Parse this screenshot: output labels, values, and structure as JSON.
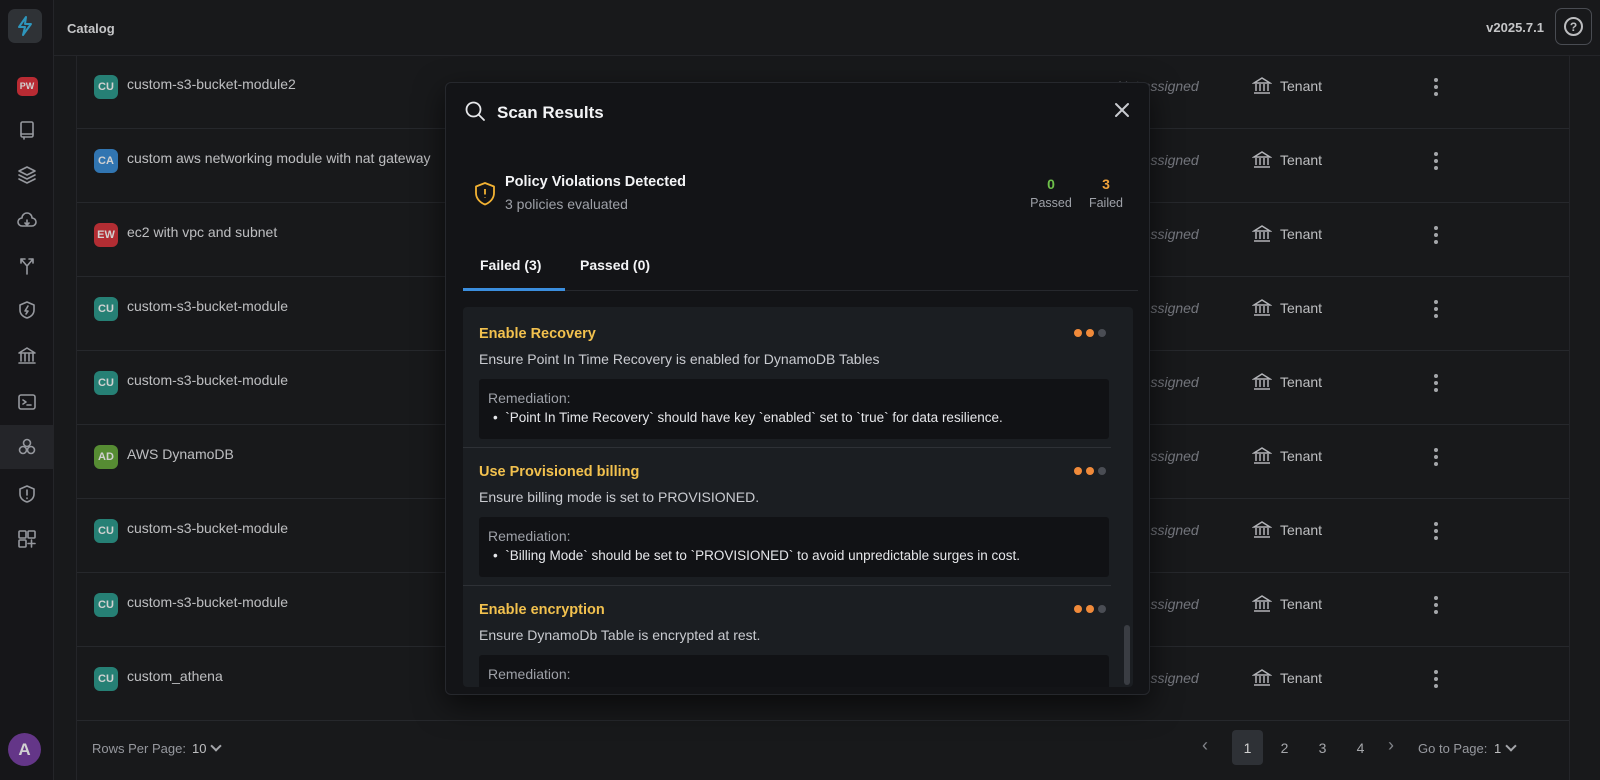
{
  "header": {
    "title": "Catalog",
    "version": "v2025.7.1",
    "help_icon": "help-circle-icon"
  },
  "sidebar": {
    "logo": "app-logo",
    "badge": "PW",
    "items": [
      {
        "icon": "book-icon"
      },
      {
        "icon": "layers-icon"
      },
      {
        "icon": "cloud-icon"
      },
      {
        "icon": "fork-icon"
      },
      {
        "icon": "shield-bolt-icon"
      },
      {
        "icon": "bank-icon"
      },
      {
        "icon": "terminal-icon"
      },
      {
        "icon": "modules-icon"
      },
      {
        "icon": "shield-alert-icon"
      },
      {
        "icon": "add-widget-icon"
      }
    ],
    "user_initial": "A"
  },
  "table": {
    "rows": [
      {
        "initials": "CU",
        "color": "#2f9d8f",
        "name": "custom-s3-bucket-module2",
        "assigned": "Not assigned",
        "scope": "Tenant"
      },
      {
        "initials": "CA",
        "color": "#3c8fd8",
        "name": "custom aws networking module with nat gateway",
        "assigned": "Not assigned",
        "scope": "Tenant"
      },
      {
        "initials": "EW",
        "color": "#d9383f",
        "name": "ec2 with vpc and subnet",
        "assigned": "Not assigned",
        "scope": "Tenant"
      },
      {
        "initials": "CU",
        "color": "#2f9d8f",
        "name": "custom-s3-bucket-module",
        "assigned": "Not assigned",
        "scope": "Tenant"
      },
      {
        "initials": "CU",
        "color": "#2f9d8f",
        "name": "custom-s3-bucket-module",
        "assigned": "Not assigned",
        "scope": "Tenant"
      },
      {
        "initials": "AD",
        "color": "#6aab3f",
        "name": "AWS DynamoDB",
        "assigned": "Not assigned",
        "scope": "Tenant"
      },
      {
        "initials": "CU",
        "color": "#2f9d8f",
        "name": "custom-s3-bucket-module",
        "assigned": "Not assigned",
        "scope": "Tenant"
      },
      {
        "initials": "CU",
        "color": "#2f9d8f",
        "name": "custom-s3-bucket-module",
        "assigned": "Not assigned",
        "scope": "Tenant"
      },
      {
        "initials": "CU",
        "color": "#2f9d8f",
        "name": "custom_athena",
        "assigned": "Not assigned",
        "scope": "Tenant"
      }
    ]
  },
  "pagination": {
    "rows_per_page_label": "Rows Per Page:",
    "rows_per_page": "10",
    "pages": [
      "1",
      "2",
      "3",
      "4"
    ],
    "current_page": "1",
    "goto_label": "Go to Page:",
    "goto_value": "1"
  },
  "modal": {
    "title": "Scan Results",
    "summary_title": "Policy Violations Detected",
    "summary_sub": "3 policies evaluated",
    "passed_count": "0",
    "passed_label": "Passed",
    "failed_count": "3",
    "failed_label": "Failed",
    "tabs": [
      "Failed (3)",
      "Passed (0)"
    ],
    "results": [
      {
        "title": "Enable Recovery",
        "desc": "Ensure Point In Time Recovery is enabled for DynamoDB Tables",
        "remediation_label": "Remediation:",
        "remediation": "`Point In Time Recovery` should have key `enabled` set to `true` for data resilience."
      },
      {
        "title": "Use Provisioned billing",
        "desc": "Ensure billing mode is set to PROVISIONED.",
        "remediation_label": "Remediation:",
        "remediation": "`Billing Mode` should be set to `PROVISIONED` to avoid unpredictable surges in cost."
      },
      {
        "title": "Enable encryption",
        "desc": "Ensure DynamoDb Table is encrypted at rest.",
        "remediation_label": "Remediation:",
        "remediation": ""
      }
    ],
    "colors": {
      "passed": "#6ec04a",
      "failed": "#f0a23a",
      "severity_on": "#f08a3a",
      "severity_off": "#4a4d54"
    }
  }
}
